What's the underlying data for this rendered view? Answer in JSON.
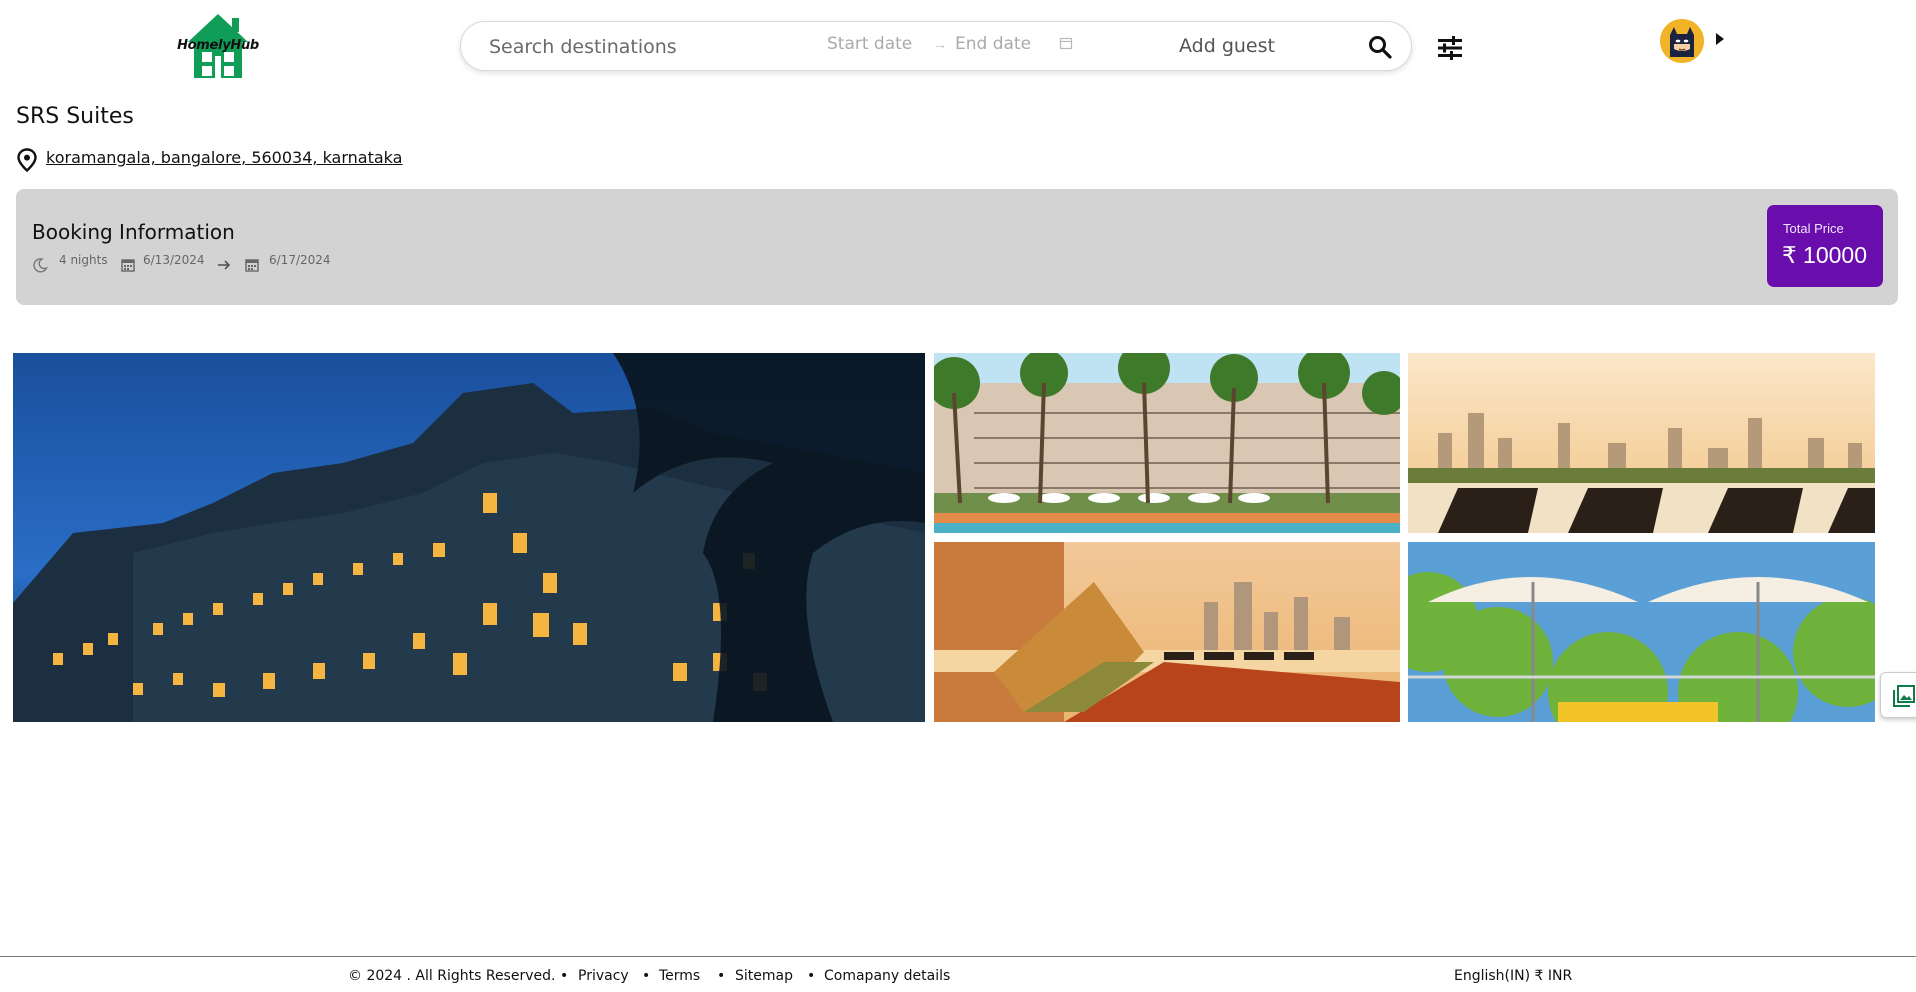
{
  "header": {
    "logo_text": "HomelyHub",
    "search_placeholder": "Search destinations",
    "start_date_placeholder": "Start date",
    "date_separator": "→",
    "end_date_placeholder": "End date",
    "guest_placeholder": "Add guest",
    "icons": [
      "home-logo",
      "search-icon",
      "calendar-icon",
      "filter-icon",
      "avatar",
      "caret-right-icon"
    ]
  },
  "property": {
    "name": "SRS Suites",
    "address": "koramangala, bangalore, 560034, karnataka"
  },
  "booking": {
    "title": "Booking Information",
    "nights": "4 nights",
    "check_in": "6/13/2024",
    "check_out": "6/17/2024",
    "total_label": "Total Price",
    "total_value": "₹ 10000",
    "accent_color": "#6a0dad",
    "card_color": "#d3d3d3"
  },
  "gallery": {
    "images": [
      "hotel-night-exterior",
      "resort-pool-palms",
      "rooftop-loungers-skyline",
      "sunset-deckchair-pool",
      "garden-umbrellas"
    ],
    "show_all_icon": "photo-library-icon"
  },
  "footer": {
    "copyright": "© 2024 . All Rights Reserved.",
    "links": [
      "Privacy",
      "Terms",
      "Sitemap",
      "Comapany details"
    ],
    "locale": "English(IN) ₹ INR"
  }
}
